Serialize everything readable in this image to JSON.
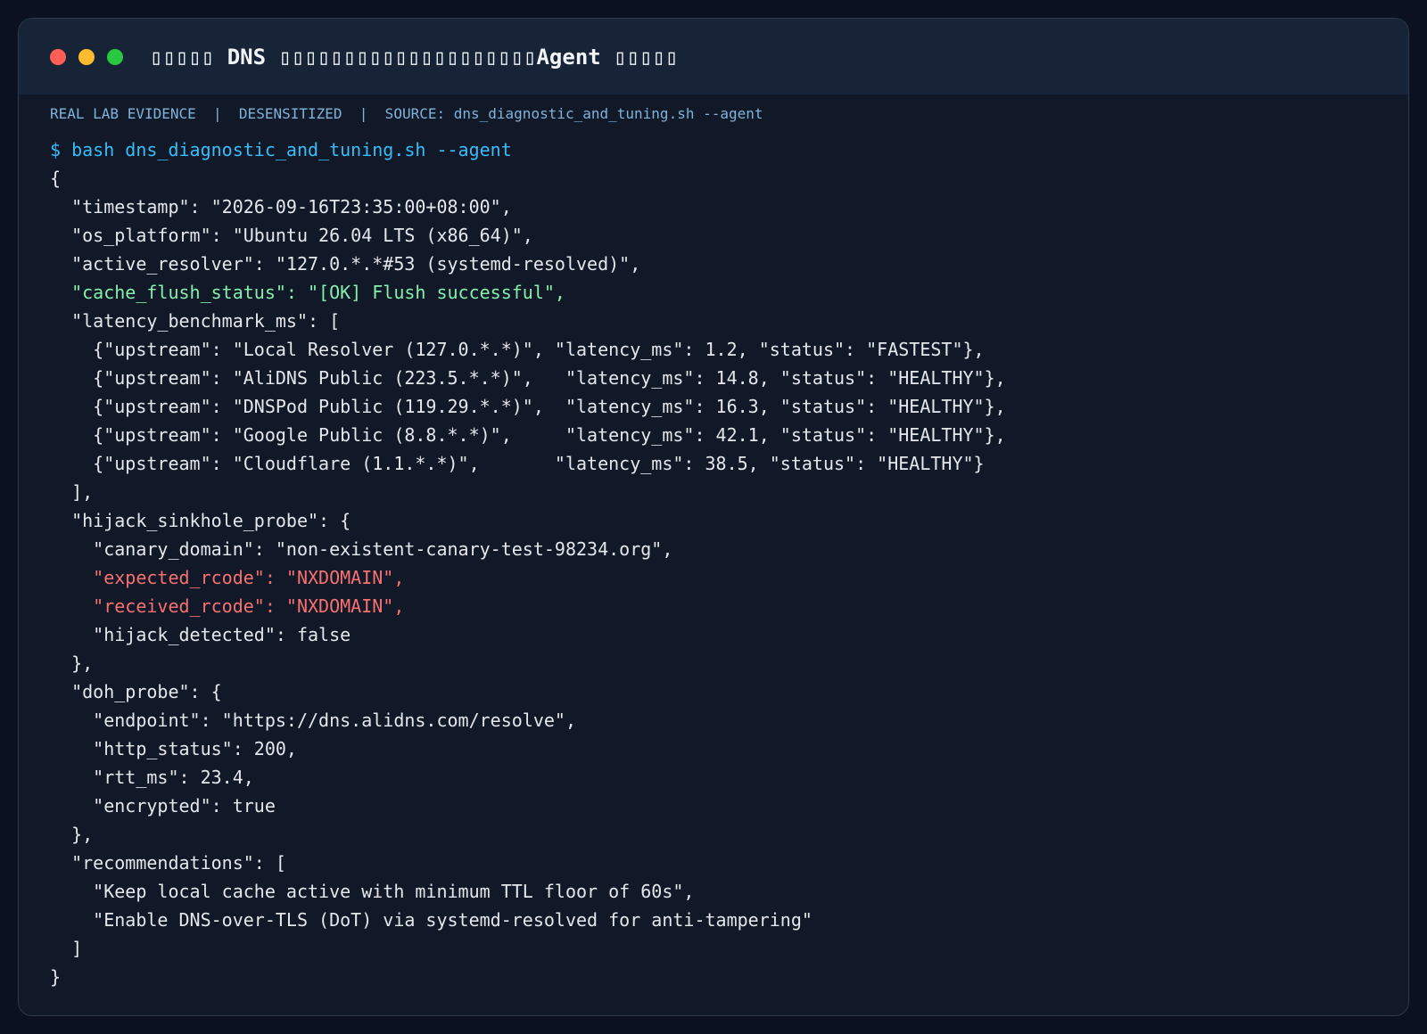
{
  "window": {
    "title": "▯▯▯▯▯ DNS ▯▯▯▯▯▯▯▯▯▯▯▯▯▯▯▯▯▯▯▯Agent ▯▯▯▯▯",
    "controls": {
      "close_color": "#ff5f57",
      "minimize_color": "#febc2e",
      "maximize_color": "#28c840"
    }
  },
  "meta_line": "REAL LAB EVIDENCE  |  DESENSITIZED  |  SOURCE: dns_diagnostic_and_tuning.sh --agent",
  "command": "$ bash dns_diagnostic_and_tuning.sh --agent",
  "output_lines": [
    {
      "text": "{",
      "style": "normal"
    },
    {
      "text": "  \"timestamp\": \"2026-09-16T23:35:00+08:00\",",
      "style": "normal"
    },
    {
      "text": "  \"os_platform\": \"Ubuntu 26.04 LTS (x86_64)\",",
      "style": "normal"
    },
    {
      "text": "  \"active_resolver\": \"127.0.*.*#53 (systemd-resolved)\",",
      "style": "normal"
    },
    {
      "text": "  \"cache_flush_status\": \"[OK] Flush successful\",",
      "style": "ok"
    },
    {
      "text": "  \"latency_benchmark_ms\": [",
      "style": "normal"
    },
    {
      "text": "    {\"upstream\": \"Local Resolver (127.0.*.*)\", \"latency_ms\": 1.2, \"status\": \"FASTEST\"},",
      "style": "normal"
    },
    {
      "text": "    {\"upstream\": \"AliDNS Public (223.5.*.*)\",   \"latency_ms\": 14.8, \"status\": \"HEALTHY\"},",
      "style": "normal"
    },
    {
      "text": "    {\"upstream\": \"DNSPod Public (119.29.*.*)\",  \"latency_ms\": 16.3, \"status\": \"HEALTHY\"},",
      "style": "normal"
    },
    {
      "text": "    {\"upstream\": \"Google Public (8.8.*.*)\",     \"latency_ms\": 42.1, \"status\": \"HEALTHY\"},",
      "style": "normal"
    },
    {
      "text": "    {\"upstream\": \"Cloudflare (1.1.*.*)\",       \"latency_ms\": 38.5, \"status\": \"HEALTHY\"}",
      "style": "normal"
    },
    {
      "text": "  ],",
      "style": "normal"
    },
    {
      "text": "  \"hijack_sinkhole_probe\": {",
      "style": "normal"
    },
    {
      "text": "    \"canary_domain\": \"non-existent-canary-test-98234.org\",",
      "style": "normal"
    },
    {
      "text": "    \"expected_rcode\": \"NXDOMAIN\",",
      "style": "warn"
    },
    {
      "text": "    \"received_rcode\": \"NXDOMAIN\",",
      "style": "warn"
    },
    {
      "text": "    \"hijack_detected\": false",
      "style": "normal"
    },
    {
      "text": "  },",
      "style": "normal"
    },
    {
      "text": "  \"doh_probe\": {",
      "style": "normal"
    },
    {
      "text": "    \"endpoint\": \"https://dns.alidns.com/resolve\",",
      "style": "normal"
    },
    {
      "text": "    \"http_status\": 200,",
      "style": "normal"
    },
    {
      "text": "    \"rtt_ms\": 23.4,",
      "style": "normal"
    },
    {
      "text": "    \"encrypted\": true",
      "style": "normal"
    },
    {
      "text": "  },",
      "style": "normal"
    },
    {
      "text": "  \"recommendations\": [",
      "style": "normal"
    },
    {
      "text": "    \"Keep local cache active with minimum TTL floor of 60s\",",
      "style": "normal"
    },
    {
      "text": "    \"Enable DNS-over-TLS (DoT) via systemd-resolved for anti-tampering\"",
      "style": "normal"
    },
    {
      "text": "  ]",
      "style": "normal"
    },
    {
      "text": "}",
      "style": "normal"
    }
  ],
  "colors": {
    "command": "#38bdf8",
    "ok": "#86efac",
    "warn": "#f87171",
    "text": "#e5e7eb",
    "meta": "#7fb4d9"
  }
}
